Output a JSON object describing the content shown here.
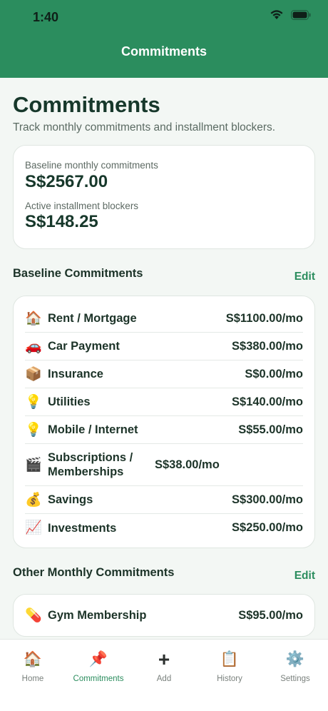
{
  "status_bar": {
    "time": "1:40"
  },
  "nav": {
    "title": "Commitments"
  },
  "page": {
    "title": "Commitments",
    "subtitle": "Track monthly commitments and installment blockers."
  },
  "summary": {
    "baseline_label": "Baseline monthly commitments",
    "baseline_value": "S$2567.00",
    "blockers_label": "Active installment blockers",
    "blockers_value": "S$148.25"
  },
  "baseline_section": {
    "title": "Baseline Commitments",
    "edit_label": "Edit",
    "items": [
      {
        "icon": "🏠",
        "icon_name": "house-icon",
        "label": "Rent / Mortgage",
        "amount": "S$1100.00/mo"
      },
      {
        "icon": "🚗",
        "icon_name": "car-icon",
        "label": "Car Payment",
        "amount": "S$380.00/mo"
      },
      {
        "icon": "📦",
        "icon_name": "package-icon",
        "label": "Insurance",
        "amount": "S$0.00/mo"
      },
      {
        "icon": "💡",
        "icon_name": "lightbulb-icon",
        "label": "Utilities",
        "amount": "S$140.00/mo"
      },
      {
        "icon": "💡",
        "icon_name": "lightbulb-icon",
        "label": "Mobile / Internet",
        "amount": "S$55.00/mo"
      },
      {
        "icon": "🎬",
        "icon_name": "clapperboard-icon",
        "label": "Subscriptions / Memberships",
        "amount": "S$38.00/mo"
      },
      {
        "icon": "💰",
        "icon_name": "money-bag-icon",
        "label": "Savings",
        "amount": "S$300.00/mo"
      },
      {
        "icon": "📈",
        "icon_name": "chart-increasing-icon",
        "label": "Investments",
        "amount": "S$250.00/mo"
      }
    ]
  },
  "other_section": {
    "title": "Other Monthly Commitments",
    "edit_label": "Edit",
    "items": [
      {
        "icon": "💊",
        "icon_name": "pill-icon",
        "label": "Gym Membership",
        "amount": "S$95.00/mo"
      }
    ]
  },
  "tabbar": {
    "active": "Commitments",
    "tabs": [
      {
        "icon": "🏠",
        "icon_name": "home-icon",
        "label": "Home"
      },
      {
        "icon": "📌",
        "icon_name": "pushpin-icon",
        "label": "Commitments"
      },
      {
        "icon": "+",
        "icon_name": "plus-icon",
        "label": "Add"
      },
      {
        "icon": "📋",
        "icon_name": "clipboard-icon",
        "label": "History"
      },
      {
        "icon": "⚙️",
        "icon_name": "gear-icon",
        "label": "Settings"
      }
    ]
  },
  "colors": {
    "brand": "#2b8d5e",
    "text_dark": "#17382b",
    "background": "#f3f7f4"
  }
}
